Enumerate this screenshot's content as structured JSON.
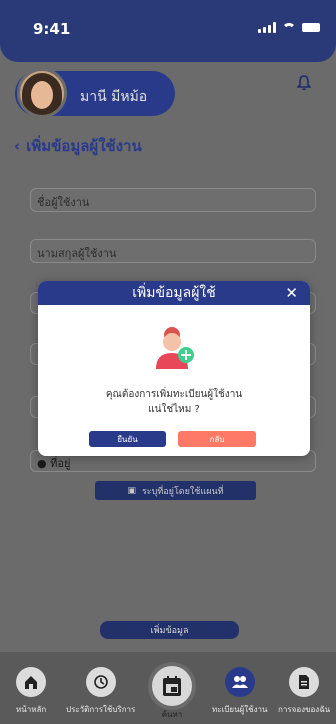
{
  "status_bar": {
    "time": "9:41"
  },
  "profile": {
    "name": "มานี มีหม้อ"
  },
  "page": {
    "title": "เพิ่มข้อมูลผู้ใช้งาน"
  },
  "form": {
    "first_name_placeholder": "ชื่อผู้ใช้งาน",
    "last_name_placeholder": "นามสกุลผู้ใช้งาน",
    "address_value": "ที่อยู่",
    "map_button_label": "ระบุที่อยู่โดยใช้แผนที่",
    "submit_label": "เพิ่มข้อมูล"
  },
  "modal": {
    "title": "เพิ่มข้อมูลผู้ใช้",
    "message_line1": "คุณต้องการเพิ่มทะเบียนผู้ใช้งาน",
    "message_line2": "แน่ใช่ไหม ?",
    "confirm_label": "ยืนยัน",
    "back_label": "กลับ"
  },
  "bottom_nav": {
    "home": "หน้าหลัก",
    "history": "ประวัติการใช้บริการ",
    "search": "ค้นหา",
    "register": "ทะเบียนผู้ใช้งาน",
    "booking": "การจองของฉัน"
  },
  "colors": {
    "primary": "#2a3a8a",
    "danger": "#ff7a66"
  }
}
